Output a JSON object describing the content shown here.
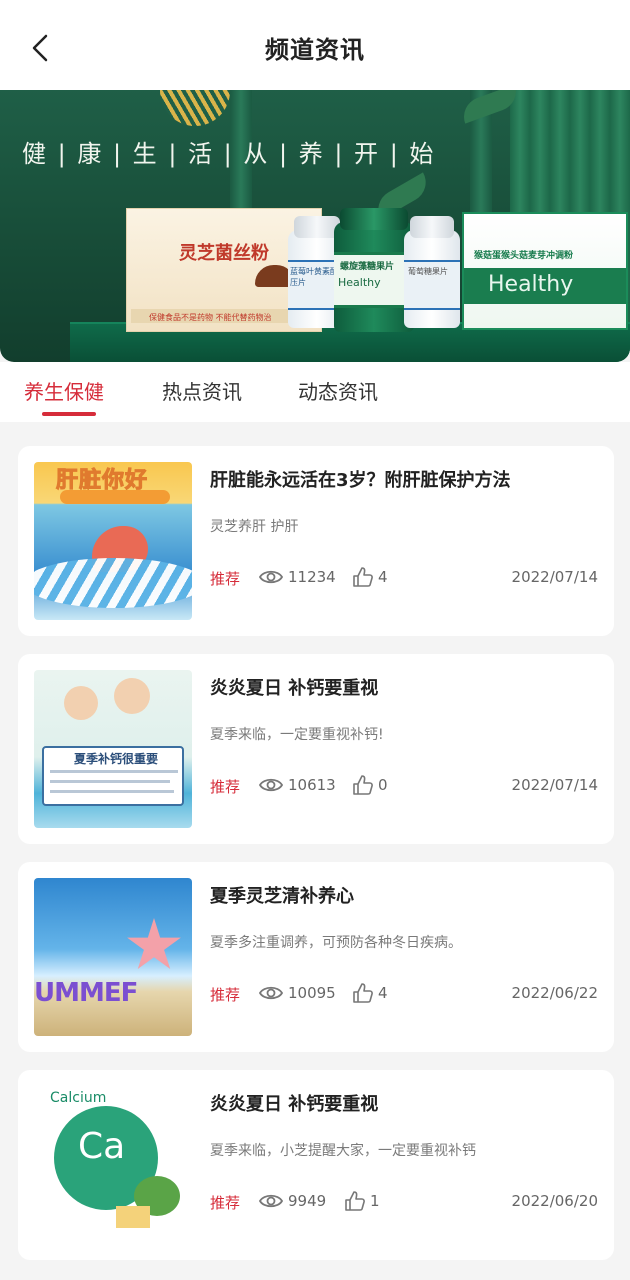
{
  "header": {
    "title": "频道资讯",
    "back_icon": "chevron-left-icon"
  },
  "banner": {
    "slogan": "健 | 康 | 生 | 活 | 从 | 养 | 开 | 始",
    "products": {
      "box1_name": "灵芝菌丝粉",
      "box1_notice": "保健食品不是药物  不能代替药物治",
      "bottle1_label": "蓝莓叶黄素酯压片",
      "bottle2_label": "螺旋藻糖果片",
      "bottle2_brand": "Healthy",
      "bottle3_label": "葡萄糖果片",
      "box2_name": "猴菇蛋猴头菇麦芽冲调粉",
      "box2_brand": "Healthy"
    },
    "colors": {
      "primary": "#1f5f47",
      "accent": "#d9b44a"
    }
  },
  "tabs": [
    {
      "label": "养生保健",
      "active": true
    },
    {
      "label": "热点资讯",
      "active": false
    },
    {
      "label": "动态资讯",
      "active": false
    }
  ],
  "accent_color": "#d62c3a",
  "articles": [
    {
      "title": "肝脏能永远活在3岁？附肝脏保护方法",
      "subtitle": "灵芝养肝 护肝",
      "tag": "推荐",
      "views": "11234",
      "likes": "4",
      "date": "2022/07/14",
      "thumb_text": "肝脏你好"
    },
    {
      "title": "炎炎夏日 补钙要重视",
      "subtitle": "夏季来临，一定要重视补钙!",
      "tag": "推荐",
      "views": "10613",
      "likes": "0",
      "date": "2022/07/14",
      "thumb_text": "夏季补钙很重要"
    },
    {
      "title": "夏季灵芝清补养心",
      "subtitle": "夏季多注重调养，可预防各种冬日疾病。",
      "tag": "推荐",
      "views": "10095",
      "likes": "4",
      "date": "2022/06/22",
      "thumb_text": "UMMEF"
    },
    {
      "title": "炎炎夏日 补钙要重视",
      "subtitle": "夏季来临，小芝提醒大家，一定要重视补钙",
      "tag": "推荐",
      "views": "9949",
      "likes": "1",
      "date": "2022/06/20",
      "thumb_text": "Ca",
      "thumb_caption": "Calcium"
    }
  ]
}
